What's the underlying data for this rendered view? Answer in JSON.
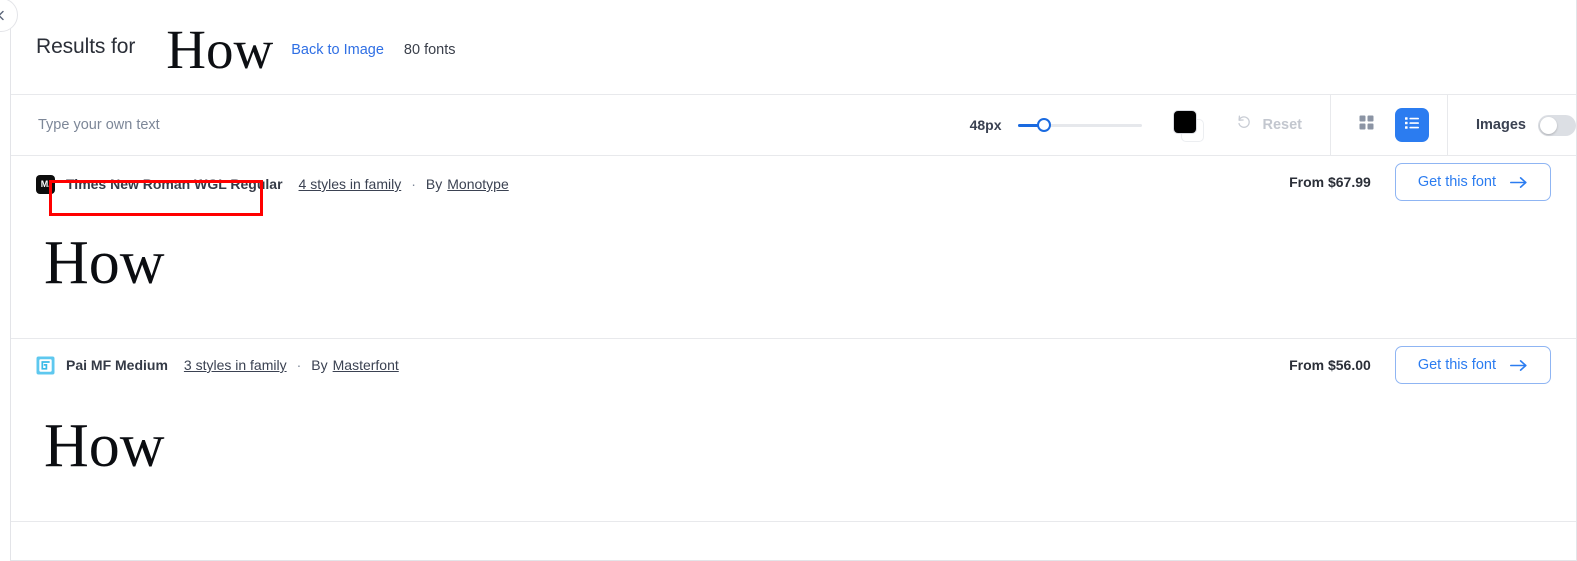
{
  "nav": {
    "back_icon": "chevron-left-icon"
  },
  "header": {
    "results_label": "Results for",
    "query": "How",
    "back_to_image": "Back to Image",
    "font_count": "80 fonts"
  },
  "toolbar": {
    "text_input_value": "",
    "text_input_placeholder": "Type your own text",
    "size_label": "48px",
    "size_value": 48,
    "size_min": 12,
    "size_max": 180,
    "color_swatch": "#000000",
    "reset_label": "Reset",
    "reset_enabled": false,
    "view_grid_icon": "grid-view-icon",
    "view_list_icon": "list-view-icon",
    "active_view": "list",
    "images_label": "Images",
    "images_enabled": false
  },
  "results": [
    {
      "foundry_icon_label": "M.",
      "foundry_icon_type": "monotype-logo-icon",
      "font_name": "Times New Roman WGL Regular",
      "styles_in_family": "4 styles in family",
      "by_label": "By",
      "foundry": "Monotype",
      "price": "From $67.99",
      "cta_label": "Get this font",
      "preview_text": "How",
      "highlighted": true
    },
    {
      "foundry_icon_label": "",
      "foundry_icon_type": "masterfont-logo-icon",
      "font_name": "Pai MF Medium",
      "styles_in_family": "3 styles in family",
      "by_label": "By",
      "foundry": "Masterfont",
      "price": "From $56.00",
      "cta_label": "Get this font",
      "preview_text": "How",
      "highlighted": false
    }
  ],
  "colors": {
    "accent_blue": "#2b7cf0",
    "link_blue": "#2f6fe4",
    "slider_blue": "#1a6ae0",
    "highlight_red": "#ff0000",
    "border_gray": "#e8e9ec",
    "text_dark": "#2b2f38",
    "text_muted": "#7d8798"
  }
}
